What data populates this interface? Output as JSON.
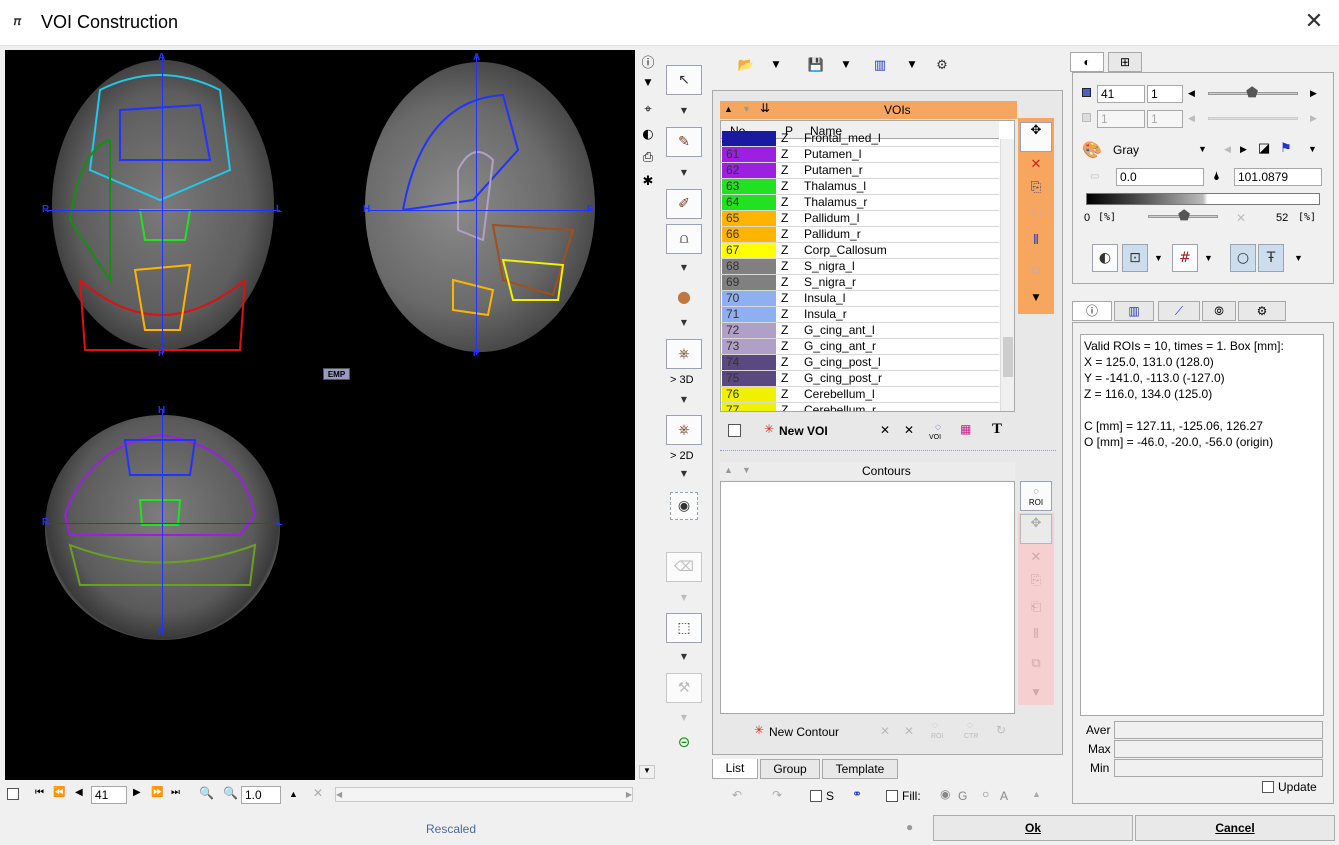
{
  "window": {
    "title": "VOI Construction",
    "app_icon": "pmod-icon",
    "close_glyph": "✕"
  },
  "viewer": {
    "orientation_labels": {
      "anterior": "A",
      "posterior": "P",
      "right": "R",
      "left": "L",
      "head": "H",
      "foot": "F"
    },
    "emp_label": "EMP"
  },
  "left_toolbar": {
    "buttons": [
      "info",
      "triangle",
      "cursor-tool",
      "contrast",
      "print",
      "settings"
    ]
  },
  "tools": {
    "to3d_label": "> 3D",
    "to2d_label": "> 2D"
  },
  "bottom_nav": {
    "slice_value": "41",
    "zoom_value": "1.0"
  },
  "status": {
    "rescaled": "Rescaled"
  },
  "voi_panel": {
    "header": "VOIs",
    "columns": [
      "No.",
      "P",
      "Name"
    ],
    "rows": [
      {
        "no": "",
        "p": "Z",
        "name": "Frontal_med_l",
        "color": "#1a1aa0"
      },
      {
        "no": "61",
        "p": "Z",
        "name": "Putamen_l",
        "color": "#9b20e0"
      },
      {
        "no": "62",
        "p": "Z",
        "name": "Putamen_r",
        "color": "#9b20e0"
      },
      {
        "no": "63",
        "p": "Z",
        "name": "Thalamus_l",
        "color": "#22e022"
      },
      {
        "no": "64",
        "p": "Z",
        "name": "Thalamus_r",
        "color": "#22e022"
      },
      {
        "no": "65",
        "p": "Z",
        "name": "Pallidum_l",
        "color": "#ffb400"
      },
      {
        "no": "66",
        "p": "Z",
        "name": "Pallidum_r",
        "color": "#ffb400"
      },
      {
        "no": "67",
        "p": "Z",
        "name": "Corp_Callosum",
        "color": "#ffff00"
      },
      {
        "no": "68",
        "p": "Z",
        "name": "S_nigra_l",
        "color": "#808080"
      },
      {
        "no": "69",
        "p": "Z",
        "name": "S_nigra_r",
        "color": "#808080"
      },
      {
        "no": "70",
        "p": "Z",
        "name": "Insula_l",
        "color": "#8fb0f0"
      },
      {
        "no": "71",
        "p": "Z",
        "name": "Insula_r",
        "color": "#8fb0f0"
      },
      {
        "no": "72",
        "p": "Z",
        "name": "G_cing_ant_l",
        "color": "#b0a0c8"
      },
      {
        "no": "73",
        "p": "Z",
        "name": "G_cing_ant_r",
        "color": "#b0a0c8"
      },
      {
        "no": "74",
        "p": "Z",
        "name": "G_cing_post_l",
        "color": "#5a4880"
      },
      {
        "no": "75",
        "p": "Z",
        "name": "G_cing_post_r",
        "color": "#5a4880"
      },
      {
        "no": "76",
        "p": "Z",
        "name": "Cerebellum_l",
        "color": "#f0f000"
      },
      {
        "no": "77",
        "p": "Z",
        "name": "Cerebellum_r",
        "color": "#f0f000"
      }
    ],
    "new_voi_label": "New VOI",
    "voi_sub": "VOI"
  },
  "contours_panel": {
    "header": "Contours",
    "new_contour_label": "New Contour",
    "roi_label": "ROI",
    "ctr_label": "CTR"
  },
  "bottom_tabs": [
    "List",
    "Group",
    "Template"
  ],
  "bottom_controls": {
    "s_label": "S",
    "fill_label": "Fill:",
    "g_label": "G",
    "a_label": "A"
  },
  "image_panel": {
    "frame_value": "41",
    "frame_value2": "1",
    "frame_dim1": "1",
    "frame_dim2": "1",
    "colormap": "Gray",
    "min_value": "0.0",
    "max_value": "101.0879",
    "pct_left": "0",
    "pct_unit": "[%]",
    "pct_right": "52",
    "pct_unit2": "[%]"
  },
  "info_panel": {
    "lines": [
      "Valid ROIs = 10, times = 1.  Box [mm]:",
      "X = 125.0, 131.0 (128.0)",
      "Y = -141.0, -113.0 (-127.0)",
      "Z = 116.0, 134.0 (125.0)",
      "",
      "C [mm] = 127.11, -125.06, 126.27",
      "O [mm] = -46.0, -20.0, -56.0 (origin)"
    ],
    "aver_label": "Aver",
    "max_label": "Max",
    "min_label": "Min",
    "update_label": "Update"
  },
  "buttons": {
    "ok": "Ok",
    "cancel": "Cancel"
  }
}
